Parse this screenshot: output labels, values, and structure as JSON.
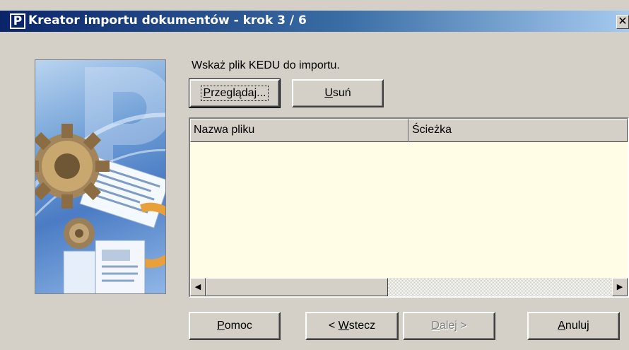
{
  "window": {
    "title": "Kreator importu dokumentów - krok 3 / 6",
    "app_icon_letter": "P",
    "close_glyph": "✕"
  },
  "instruction": "Wskaż plik KEDU do importu.",
  "buttons": {
    "browse": {
      "underlined": "P",
      "rest": "rzeglądaj..."
    },
    "remove": {
      "underlined": "U",
      "rest": "suń"
    },
    "help": {
      "underlined": "P",
      "rest": "omoc"
    },
    "back": {
      "prefix": "< ",
      "underlined": "W",
      "rest": "stecz"
    },
    "next": {
      "underlined": "D",
      "rest": "alej >"
    },
    "cancel": {
      "underlined": "A",
      "rest": "nuluj"
    }
  },
  "file_list": {
    "columns": [
      "Nazwa pliku",
      "Ścieżka"
    ],
    "rows": [],
    "background": "#fffde6"
  },
  "scrollbar": {
    "left_glyph": "◀",
    "right_glyph": "▶"
  },
  "colors": {
    "titlebar_start": "#0a246a",
    "titlebar_end": "#a6caf0",
    "dialog_bg": "#d4d0c8"
  },
  "icons": [
    "app-logo-icon",
    "close-icon",
    "wizard-illustration",
    "scroll-left-icon",
    "scroll-right-icon"
  ]
}
